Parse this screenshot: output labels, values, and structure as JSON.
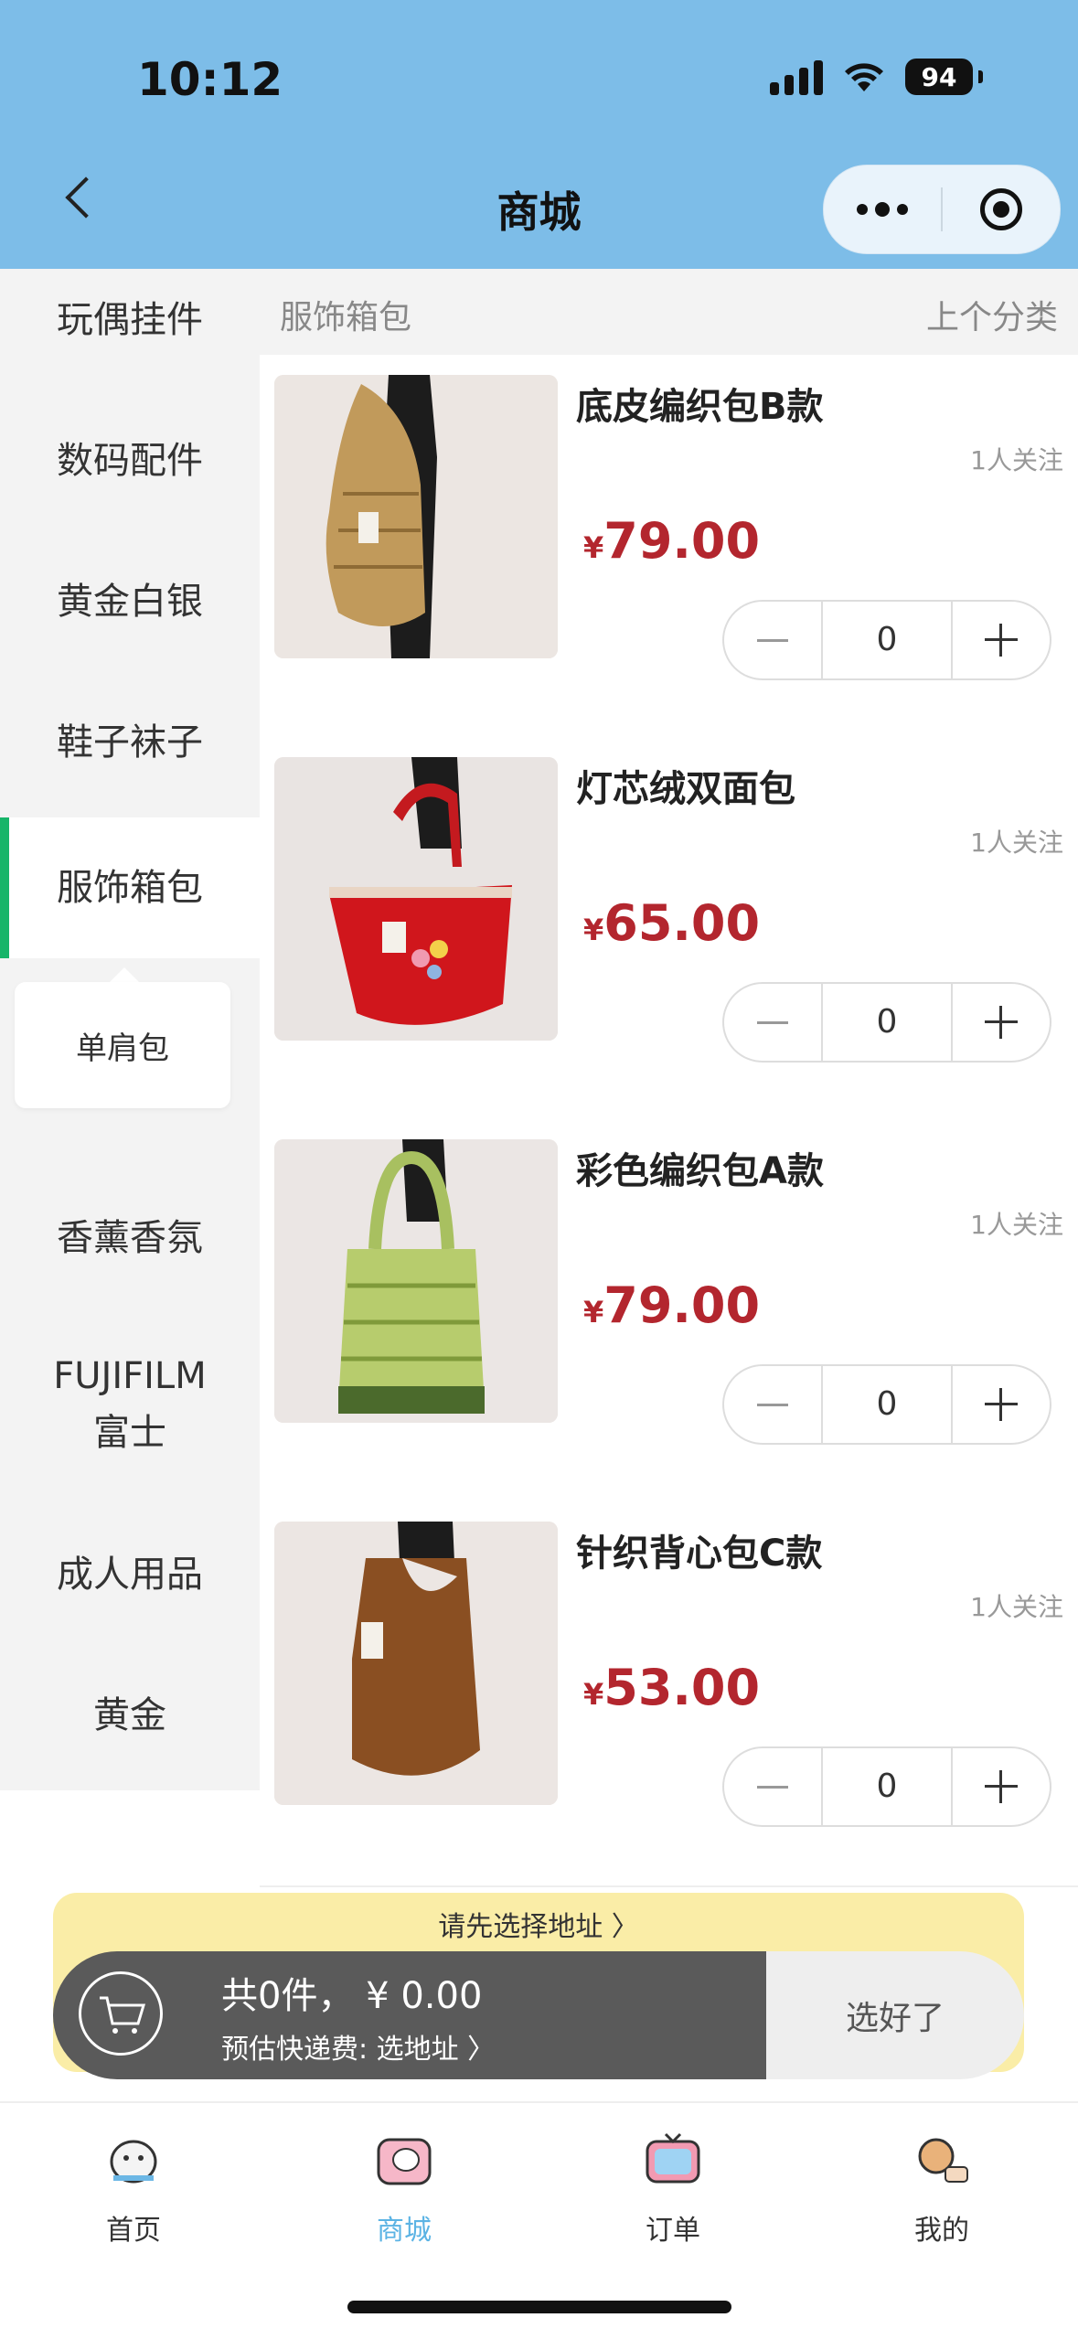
{
  "status": {
    "time": "10:12",
    "battery": "94"
  },
  "nav": {
    "title": "商城"
  },
  "category": {
    "current": "服饰箱包",
    "prev_label": "上个分类"
  },
  "sidebar": {
    "items": [
      {
        "label": "玩偶挂件"
      },
      {
        "label": "数码配件"
      },
      {
        "label": "黄金白银"
      },
      {
        "label": "鞋子袜子"
      },
      {
        "label": "服饰箱包",
        "active": true
      },
      {
        "label": "香薰香氛"
      },
      {
        "label": "FUJIFILM 富士"
      },
      {
        "label": "成人用品"
      },
      {
        "label": "黄金"
      }
    ],
    "subcategory": "单肩包"
  },
  "products": [
    {
      "name": "底皮编织包B款",
      "follow": "1人关注",
      "currency": "¥",
      "price": "79.00",
      "qty": "0"
    },
    {
      "name": "灯芯绒双面包",
      "follow": "1人关注",
      "currency": "¥",
      "price": "65.00",
      "qty": "0"
    },
    {
      "name": "彩色编织包A款",
      "follow": "1人关注",
      "currency": "¥",
      "price": "79.00",
      "qty": "0"
    },
    {
      "name": "针织背心包C款",
      "follow": "1人关注",
      "currency": "¥",
      "price": "53.00",
      "qty": "0"
    }
  ],
  "address_tip": "请先选择地址 〉",
  "cart": {
    "total": "共0件，  ¥ 0.00",
    "shipping": "预估快递费: 选地址 〉",
    "confirm": "选好了"
  },
  "tabs": [
    {
      "label": "首页",
      "icon": "home-icon"
    },
    {
      "label": "商城",
      "icon": "shop-icon",
      "active": true
    },
    {
      "label": "订单",
      "icon": "orders-icon"
    },
    {
      "label": "我的",
      "icon": "profile-icon"
    }
  ],
  "colors": {
    "header": "#7dbde8",
    "accent": "#17b569",
    "price": "#b3262e",
    "tab_active": "#5bb3e4"
  }
}
